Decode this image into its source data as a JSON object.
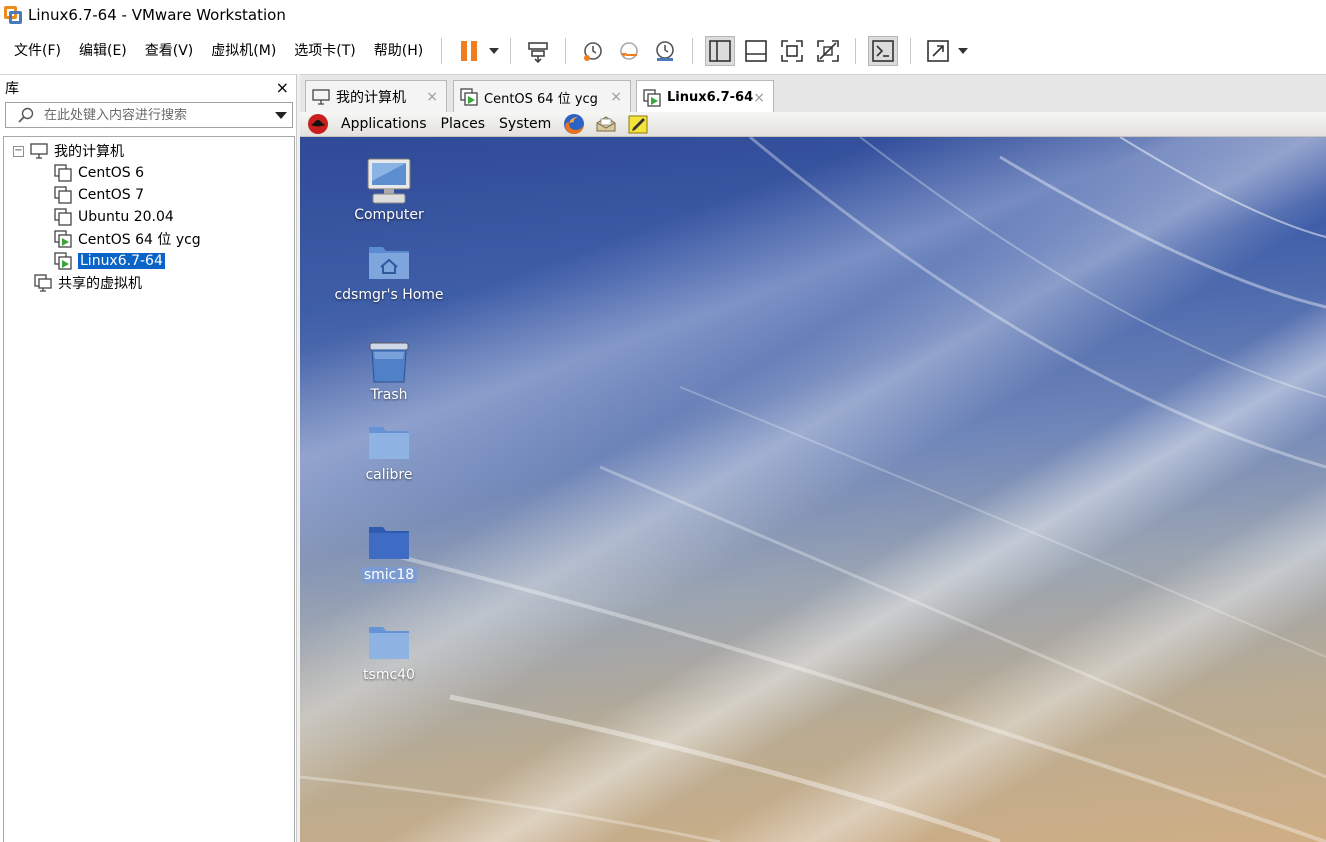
{
  "window": {
    "title": "Linux6.7-64 - VMware Workstation"
  },
  "menu": [
    "文件(F)",
    "编辑(E)",
    "查看(V)",
    "虚拟机(M)",
    "选项卡(T)",
    "帮助(H)"
  ],
  "toolbar": {
    "icons": [
      "pause-icon",
      "send-ctrl-alt-del-icon",
      "snapshot-icon",
      "revert-snapshot-icon",
      "snapshot-manager-icon",
      "show-library-icon",
      "thumbnail-bar-icon",
      "full-screen-icon",
      "unity-icon",
      "console-view-icon",
      "stretch-icon"
    ],
    "accent_color": "#f07d1e"
  },
  "library": {
    "title": "库",
    "close": "×",
    "search_placeholder": "在此处键入内容进行搜索",
    "root": "我的计算机",
    "vms": [
      {
        "name": "CentOS 6",
        "running": false,
        "selected": false
      },
      {
        "name": "CentOS 7",
        "running": false,
        "selected": false
      },
      {
        "name": "Ubuntu 20.04",
        "running": false,
        "selected": false
      },
      {
        "name": "CentOS 64 位 ycg",
        "running": true,
        "selected": false
      },
      {
        "name": "Linux6.7-64",
        "running": true,
        "selected": true
      }
    ],
    "shared": "共享的虚拟机"
  },
  "tabs": [
    {
      "label": "我的计算机",
      "active": false
    },
    {
      "label": "CentOS 64 位 ycg",
      "active": false
    },
    {
      "label": "Linux6.7-64",
      "active": true
    }
  ],
  "tab_close": "×",
  "guest": {
    "panel_menus": [
      "Applications",
      "Places",
      "System"
    ],
    "panel_icons": [
      "redhat-logo-icon",
      "firefox-icon",
      "mail-icon",
      "notes-icon"
    ],
    "desktop_icons": [
      {
        "label": "Computer",
        "type": "computer",
        "selected": false
      },
      {
        "label": "cdsmgr's Home",
        "type": "home",
        "selected": false
      },
      {
        "label": "Trash",
        "type": "trash",
        "selected": false
      },
      {
        "label": "calibre",
        "type": "folder",
        "selected": false
      },
      {
        "label": "smic18",
        "type": "folder",
        "selected": true
      },
      {
        "label": "tsmc40",
        "type": "folder",
        "selected": false
      }
    ]
  }
}
